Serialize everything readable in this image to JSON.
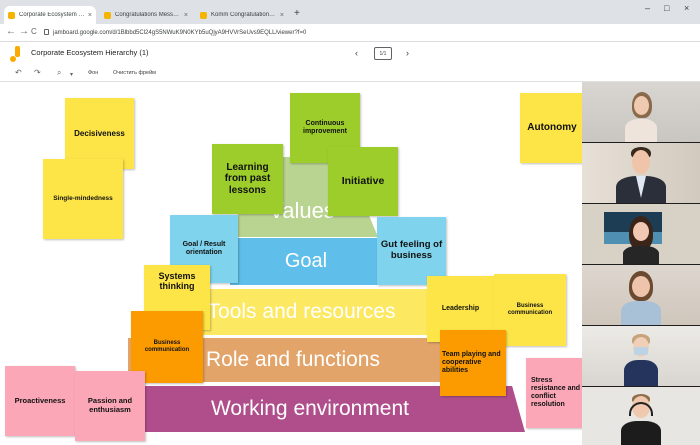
{
  "browser": {
    "tabs": [
      {
        "label": "Corporate Ecosystem Hierarchy (1)",
        "close": "×"
      },
      {
        "label": "Congratulations Message (1) - Goo...",
        "close": "×"
      },
      {
        "label": "Komm Congratulations Message (2) - C...",
        "close": "×"
      }
    ],
    "new_tab": "+",
    "window_controls": {
      "minimize": "–",
      "maximize": "□",
      "close": "×"
    },
    "url": "jamboard.google.com/d/1Blbbd5Cl24gS5NWuK9N0KYb5uQjyA9HVVrSeUvs9EQLL/viewer?f=0",
    "back": "←",
    "forward": "→",
    "reload": "C"
  },
  "app": {
    "title": "Corporate Ecosystem Hierarchy (1)",
    "frame_counter": "1/1",
    "prev": "‹",
    "next": "›"
  },
  "toolbar": {
    "undo": "↶",
    "redo": "↷",
    "zoom": "⌕",
    "zoom_dropdown": "▾",
    "background_label": "Фон",
    "clear_label": "Очистить фрейм"
  },
  "pyramid": {
    "values": "Values",
    "goal": "Goal",
    "tools": "Tools and resources",
    "role": "Role and functions",
    "env": "Working environment"
  },
  "notes": {
    "decisiveness": "Decisiveness",
    "single_mindedness": "Single-mindedness",
    "continuous_improvement": "Continuous improvement",
    "learning_from_past": "Learning from past lessons",
    "initiative": "Initiative",
    "autonomy": "Autonomy",
    "goal_result": "Goal / Result orientation",
    "gut_feeling": "Gut feeling of business",
    "systems_thinking": "Systems thinking",
    "business_comm_orange": "Business communication",
    "leadership": "Leadership",
    "business_comm_yellow": "Business communication",
    "team_playing": "Team playing and cooperative abilities",
    "proactiveness": "Proactiveness",
    "passion": "Passion and enthusiasm",
    "stress_resistance": "Stress resistance and conflict resolution"
  },
  "colors": {
    "yellow_note": "#fde547",
    "green_note": "#9ccd2a",
    "blue_note": "#7fd3ec",
    "orange_note": "#fb9b00",
    "pink_note": "#fba7b7",
    "values_band": "#b9d491",
    "goal_band": "#5fbfea",
    "tools_band": "#fce861",
    "role_band": "#e3a46a",
    "env_band": "#b04e8c"
  }
}
